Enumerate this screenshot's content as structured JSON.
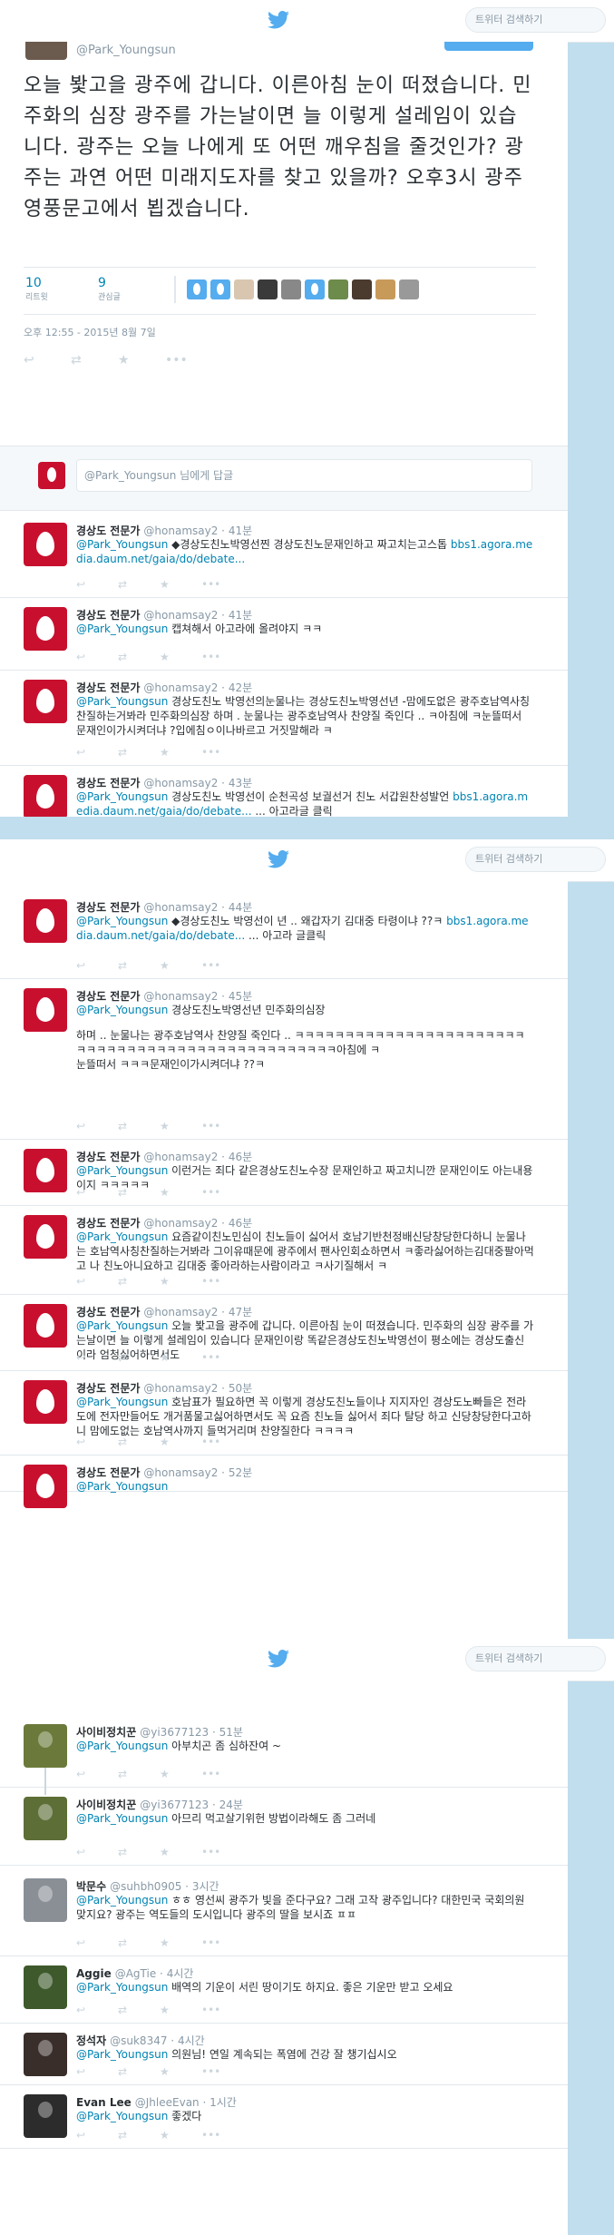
{
  "search_placeholder": "트위터 검색하기",
  "main": {
    "author_handle": "@Park_Youngsun",
    "text": "오늘 봧고을 광주에 갑니다. 이른아침 눈이 떠졌습니다. 민주화의 심장 광주를 가는날이면 늘 이렇게 설레임이 있습니다. 광주는 오늘 나에게 또 어떤 깨우침을 줄것인가? 광주는 과연 어떤 미래지도자를 찾고 있을까? 오후3시 광주 영풍문고에서 뵙겠습니다.",
    "retweets": "10",
    "retweets_label": "리트윗",
    "likes": "9",
    "likes_label": "관심글",
    "timestamp": "오후 12:55 - 2015년 8월 7일"
  },
  "reply_placeholder": "@Park_Youngsun 님에게 답글",
  "mention": "@Park_Youngsun",
  "replies1": [
    {
      "name": "경상도 전문가",
      "handle": "@honamsay2",
      "time": "41분",
      "text": "◆경상도친노박영선찐 경상도친노문재인하고 짜고치는고스톱 ",
      "link": "bbs1.agora.media.daum.net/gaia/do/debate..."
    },
    {
      "name": "경상도 전문가",
      "handle": "@honamsay2",
      "time": "41분",
      "text": "캡쳐해서 아고라에 올려야지 ㅋㅋ"
    },
    {
      "name": "경상도 전문가",
      "handle": "@honamsay2",
      "time": "42분",
      "text": "경상도친노 박영선의눈물나는 경상도친노박영선년 -맘에도없은 광주호남역사칭찬질하는거봐라 민주화의심장 하며 . 눈물나는 광주호남역사 찬양질 죽인다 .. ㅋ아침에 ㅋ눈뜰떠서 문재인이가시켜더냐 ?입에침ㅇ이나바르고 거짓말해라 ㅋ"
    },
    {
      "name": "경상도 전문가",
      "handle": "@honamsay2",
      "time": "43분",
      "text": "경상도친노 박영선이 순천곡성 보궐선거 친노 서갑원찬성발언 ",
      "link": "bbs1.agora.media.daum.net/gaia/do/debate...",
      "tail": " ... 아고라글 클릭"
    }
  ],
  "replies2": [
    {
      "name": "경상도 전문가",
      "handle": "@honamsay2",
      "time": "44분",
      "text": "◆경상도친노 박영선이 년 .. 왜갑자기 김대중 타령이냐 ??ㅋ ",
      "link": "bbs1.agora.media.daum.net/gaia/do/debate...",
      "tail": " ... 아고라 글클릭"
    },
    {
      "name": "경상도 전문가",
      "handle": "@honamsay2",
      "time": "45분",
      "text": "경상도친노박영선년 민주화의심장",
      "line2": "하며 .. 눈물나는 광주호남역사 찬양질 죽인다 .. ㅋㅋㅋㅋㅋㅋㅋㅋㅋㅋㅋㅋㅋㅋㅋㅋㅋㅋㅋㅋㅋㅋㅋㅋㅋㅋㅋㅋㅋㅋㅋㅋㅋㅋㅋㅋㅋㅋㅋㅋㅋㅋㅋㅋㅋㅋㅋㅋㅋ아침에 ㅋ",
      "line3": "눈뜰떠서 ㅋㅋㅋ문재인이가시켜더냐 ??ㅋ"
    },
    {
      "name": "경상도 전문가",
      "handle": "@honamsay2",
      "time": "46분",
      "text": "이런거는 죄다 같은경상도친노수장 문재인하고 짜고치니깐 문재인이도 아는내용이지 ㅋㅋㅋㅋㅋ"
    },
    {
      "name": "경상도 전문가",
      "handle": "@honamsay2",
      "time": "46분",
      "text": "요즘같이친노민심이 친노들이 싫어서 호남기반천정배신당창당한다하니 눈물나는 호남역사칭찬질하는거봐라 그이유때문에 광주에서 팬사인회쇼하면서 ㅋ좋라싫어하는김대중팔아먹고 나 친노아니요하고 김대중 좋아라하는사람이라고 ㅋ사기질해서 ㅋ"
    },
    {
      "name": "경상도 전문가",
      "handle": "@honamsay2",
      "time": "47분",
      "text": "오늘 봧고을 광주에 갑니다. 이른아침 눈이 떠졌습니다. 민주화의 심장 광주를 가는날이면 늘 이렇게 설레임이 있습니다 문재인이랑 똑같은경상도친노박영선이 평소에는 경상도출신이라 엄청싫어하면서도"
    },
    {
      "name": "경상도 전문가",
      "handle": "@honamsay2",
      "time": "50분",
      "text": "호남표가 필요하면 꼭 이렇게 경상도친노들이나 지지자인 경상도노빠들은 전라도에 전자만들어도 개거품물고싫어하면서도 꼭 요즘 친노들 싫어서 죄다 탈당 하고 신당창당한다고하니 맘에도없는 호남역사까지 들먹거리며 찬양질한다 ㅋㅋㅋㅋ"
    },
    {
      "name": "경상도 전문가",
      "handle": "@honamsay2",
      "time": "52분",
      "text": ""
    }
  ],
  "replies3": [
    {
      "name": "사이비정치꾼",
      "handle": "@yi3677123",
      "time": "51분",
      "text": "아부치곤 좀 심하잔여 ~"
    },
    {
      "name": "사이비정치꾼",
      "handle": "@yi3677123",
      "time": "24분",
      "text": "아므리 먹고살기위헌 방법이라해도 좀 그러네"
    },
    {
      "name": "박문수",
      "handle": "@suhbh0905",
      "time": "3시간",
      "text": "ㅎㅎ 영선씨 광주가 빛을 준다구요? 그래 고작 광주입니다? 대한민국 국회의원 맞지요? 광주는 역도들의 도시입니다 광주의 딸을 보시죠 ㅍㅍ"
    },
    {
      "name": "Aggie",
      "handle": "@AgTie",
      "time": "4시간",
      "text": "배역의 기운이 서린 땅이기도 하지요. 좋은 기운만 받고 오세요"
    },
    {
      "name": "정석자",
      "handle": "@suk8347",
      "time": "4시간",
      "text": "의원님! 연일 계속되는 폭염에 건강 잘 챙기십시오"
    },
    {
      "name": "Evan Lee",
      "handle": "@JhleeEvan",
      "time": "1시간",
      "text": "좋겠다"
    }
  ]
}
